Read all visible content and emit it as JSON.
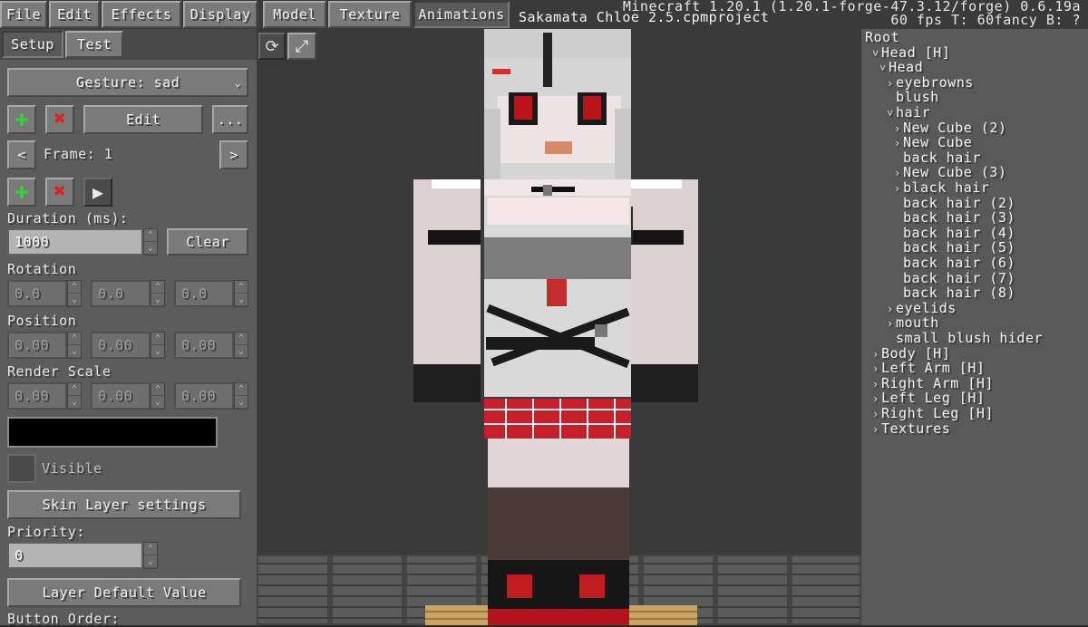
{
  "menu": {
    "items": [
      "File",
      "Edit",
      "Effects",
      "Display"
    ],
    "tabs": [
      "Model",
      "Texture",
      "Animations"
    ],
    "active_tab": "Animations"
  },
  "title": "Sakamata Chloe 2.5.cpmproject",
  "mcinfo": {
    "line1": "Minecraft 1.20.1 (1.20.1-forge-47.3.12/forge) 0.6.19a",
    "line2": "60 fps T: 60fancy B: ?"
  },
  "leftpanel": {
    "tabs": [
      "Setup",
      "Test"
    ],
    "gesture": "Gesture: sad",
    "edit_label": "Edit",
    "more_label": "...",
    "frame_label": "Frame: 1",
    "duration_label": "Duration (ms):",
    "duration_value": "1000",
    "clear_label": "Clear",
    "rotation_label": "Rotation",
    "rotation": [
      "0.0",
      "0.0",
      "0.0"
    ],
    "position_label": "Position",
    "position": [
      "0.00",
      "0.00",
      "0.00"
    ],
    "scale_label": "Render Scale",
    "scale": [
      "0.00",
      "0.00",
      "0.00"
    ],
    "color_value": "",
    "visible_label": "Visible",
    "skin_layer_label": "Skin Layer settings",
    "priority_label": "Priority:",
    "priority_value": "0",
    "layer_default_label": "Layer Default Value",
    "button_order_label": "Button Order:"
  },
  "tree": [
    {
      "label": "Root",
      "indent": 0,
      "caret": ""
    },
    {
      "label": "Head [H]",
      "indent": 1,
      "caret": "v"
    },
    {
      "label": "Head",
      "indent": 2,
      "caret": "v"
    },
    {
      "label": "eyebrowns",
      "indent": 3,
      "caret": ">"
    },
    {
      "label": "blush",
      "indent": 3,
      "caret": ""
    },
    {
      "label": "hair",
      "indent": 3,
      "caret": "v"
    },
    {
      "label": "New Cube (2)",
      "indent": 4,
      "caret": ">"
    },
    {
      "label": "New Cube",
      "indent": 4,
      "caret": ">"
    },
    {
      "label": "back hair",
      "indent": 4,
      "caret": ""
    },
    {
      "label": "New Cube (3)",
      "indent": 4,
      "caret": ">"
    },
    {
      "label": "black hair",
      "indent": 4,
      "caret": ">"
    },
    {
      "label": "back hair (2)",
      "indent": 4,
      "caret": ""
    },
    {
      "label": "back hair (3)",
      "indent": 4,
      "caret": ""
    },
    {
      "label": "back hair (4)",
      "indent": 4,
      "caret": ""
    },
    {
      "label": "back hair (5)",
      "indent": 4,
      "caret": ""
    },
    {
      "label": "back hair (6)",
      "indent": 4,
      "caret": ""
    },
    {
      "label": "back hair (7)",
      "indent": 4,
      "caret": ""
    },
    {
      "label": "back hair (8)",
      "indent": 4,
      "caret": ""
    },
    {
      "label": "eyelids",
      "indent": 3,
      "caret": ">"
    },
    {
      "label": "mouth",
      "indent": 3,
      "caret": ">"
    },
    {
      "label": "small blush hider",
      "indent": 3,
      "caret": ""
    },
    {
      "label": "Body [H]",
      "indent": 1,
      "caret": ">"
    },
    {
      "label": "Left Arm [H]",
      "indent": 1,
      "caret": ">"
    },
    {
      "label": "Right Arm [H]",
      "indent": 1,
      "caret": ">"
    },
    {
      "label": "Left Leg [H]",
      "indent": 1,
      "caret": ">"
    },
    {
      "label": "Right Leg [H]",
      "indent": 1,
      "caret": ">"
    },
    {
      "label": "Textures",
      "indent": 1,
      "caret": ">"
    }
  ]
}
